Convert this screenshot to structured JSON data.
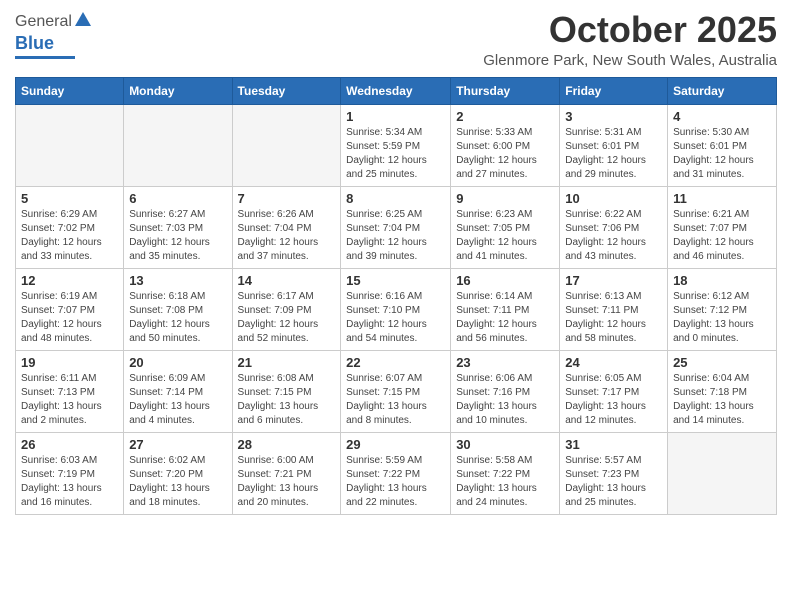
{
  "logo": {
    "general": "General",
    "blue": "Blue"
  },
  "header": {
    "month": "October 2025",
    "location": "Glenmore Park, New South Wales, Australia"
  },
  "weekdays": [
    "Sunday",
    "Monday",
    "Tuesday",
    "Wednesday",
    "Thursday",
    "Friday",
    "Saturday"
  ],
  "weeks": [
    [
      {
        "day": "",
        "info": ""
      },
      {
        "day": "",
        "info": ""
      },
      {
        "day": "",
        "info": ""
      },
      {
        "day": "1",
        "info": "Sunrise: 5:34 AM\nSunset: 5:59 PM\nDaylight: 12 hours\nand 25 minutes."
      },
      {
        "day": "2",
        "info": "Sunrise: 5:33 AM\nSunset: 6:00 PM\nDaylight: 12 hours\nand 27 minutes."
      },
      {
        "day": "3",
        "info": "Sunrise: 5:31 AM\nSunset: 6:01 PM\nDaylight: 12 hours\nand 29 minutes."
      },
      {
        "day": "4",
        "info": "Sunrise: 5:30 AM\nSunset: 6:01 PM\nDaylight: 12 hours\nand 31 minutes."
      }
    ],
    [
      {
        "day": "5",
        "info": "Sunrise: 6:29 AM\nSunset: 7:02 PM\nDaylight: 12 hours\nand 33 minutes."
      },
      {
        "day": "6",
        "info": "Sunrise: 6:27 AM\nSunset: 7:03 PM\nDaylight: 12 hours\nand 35 minutes."
      },
      {
        "day": "7",
        "info": "Sunrise: 6:26 AM\nSunset: 7:04 PM\nDaylight: 12 hours\nand 37 minutes."
      },
      {
        "day": "8",
        "info": "Sunrise: 6:25 AM\nSunset: 7:04 PM\nDaylight: 12 hours\nand 39 minutes."
      },
      {
        "day": "9",
        "info": "Sunrise: 6:23 AM\nSunset: 7:05 PM\nDaylight: 12 hours\nand 41 minutes."
      },
      {
        "day": "10",
        "info": "Sunrise: 6:22 AM\nSunset: 7:06 PM\nDaylight: 12 hours\nand 43 minutes."
      },
      {
        "day": "11",
        "info": "Sunrise: 6:21 AM\nSunset: 7:07 PM\nDaylight: 12 hours\nand 46 minutes."
      }
    ],
    [
      {
        "day": "12",
        "info": "Sunrise: 6:19 AM\nSunset: 7:07 PM\nDaylight: 12 hours\nand 48 minutes."
      },
      {
        "day": "13",
        "info": "Sunrise: 6:18 AM\nSunset: 7:08 PM\nDaylight: 12 hours\nand 50 minutes."
      },
      {
        "day": "14",
        "info": "Sunrise: 6:17 AM\nSunset: 7:09 PM\nDaylight: 12 hours\nand 52 minutes."
      },
      {
        "day": "15",
        "info": "Sunrise: 6:16 AM\nSunset: 7:10 PM\nDaylight: 12 hours\nand 54 minutes."
      },
      {
        "day": "16",
        "info": "Sunrise: 6:14 AM\nSunset: 7:11 PM\nDaylight: 12 hours\nand 56 minutes."
      },
      {
        "day": "17",
        "info": "Sunrise: 6:13 AM\nSunset: 7:11 PM\nDaylight: 12 hours\nand 58 minutes."
      },
      {
        "day": "18",
        "info": "Sunrise: 6:12 AM\nSunset: 7:12 PM\nDaylight: 13 hours\nand 0 minutes."
      }
    ],
    [
      {
        "day": "19",
        "info": "Sunrise: 6:11 AM\nSunset: 7:13 PM\nDaylight: 13 hours\nand 2 minutes."
      },
      {
        "day": "20",
        "info": "Sunrise: 6:09 AM\nSunset: 7:14 PM\nDaylight: 13 hours\nand 4 minutes."
      },
      {
        "day": "21",
        "info": "Sunrise: 6:08 AM\nSunset: 7:15 PM\nDaylight: 13 hours\nand 6 minutes."
      },
      {
        "day": "22",
        "info": "Sunrise: 6:07 AM\nSunset: 7:15 PM\nDaylight: 13 hours\nand 8 minutes."
      },
      {
        "day": "23",
        "info": "Sunrise: 6:06 AM\nSunset: 7:16 PM\nDaylight: 13 hours\nand 10 minutes."
      },
      {
        "day": "24",
        "info": "Sunrise: 6:05 AM\nSunset: 7:17 PM\nDaylight: 13 hours\nand 12 minutes."
      },
      {
        "day": "25",
        "info": "Sunrise: 6:04 AM\nSunset: 7:18 PM\nDaylight: 13 hours\nand 14 minutes."
      }
    ],
    [
      {
        "day": "26",
        "info": "Sunrise: 6:03 AM\nSunset: 7:19 PM\nDaylight: 13 hours\nand 16 minutes."
      },
      {
        "day": "27",
        "info": "Sunrise: 6:02 AM\nSunset: 7:20 PM\nDaylight: 13 hours\nand 18 minutes."
      },
      {
        "day": "28",
        "info": "Sunrise: 6:00 AM\nSunset: 7:21 PM\nDaylight: 13 hours\nand 20 minutes."
      },
      {
        "day": "29",
        "info": "Sunrise: 5:59 AM\nSunset: 7:22 PM\nDaylight: 13 hours\nand 22 minutes."
      },
      {
        "day": "30",
        "info": "Sunrise: 5:58 AM\nSunset: 7:22 PM\nDaylight: 13 hours\nand 24 minutes."
      },
      {
        "day": "31",
        "info": "Sunrise: 5:57 AM\nSunset: 7:23 PM\nDaylight: 13 hours\nand 25 minutes."
      },
      {
        "day": "",
        "info": ""
      }
    ]
  ]
}
